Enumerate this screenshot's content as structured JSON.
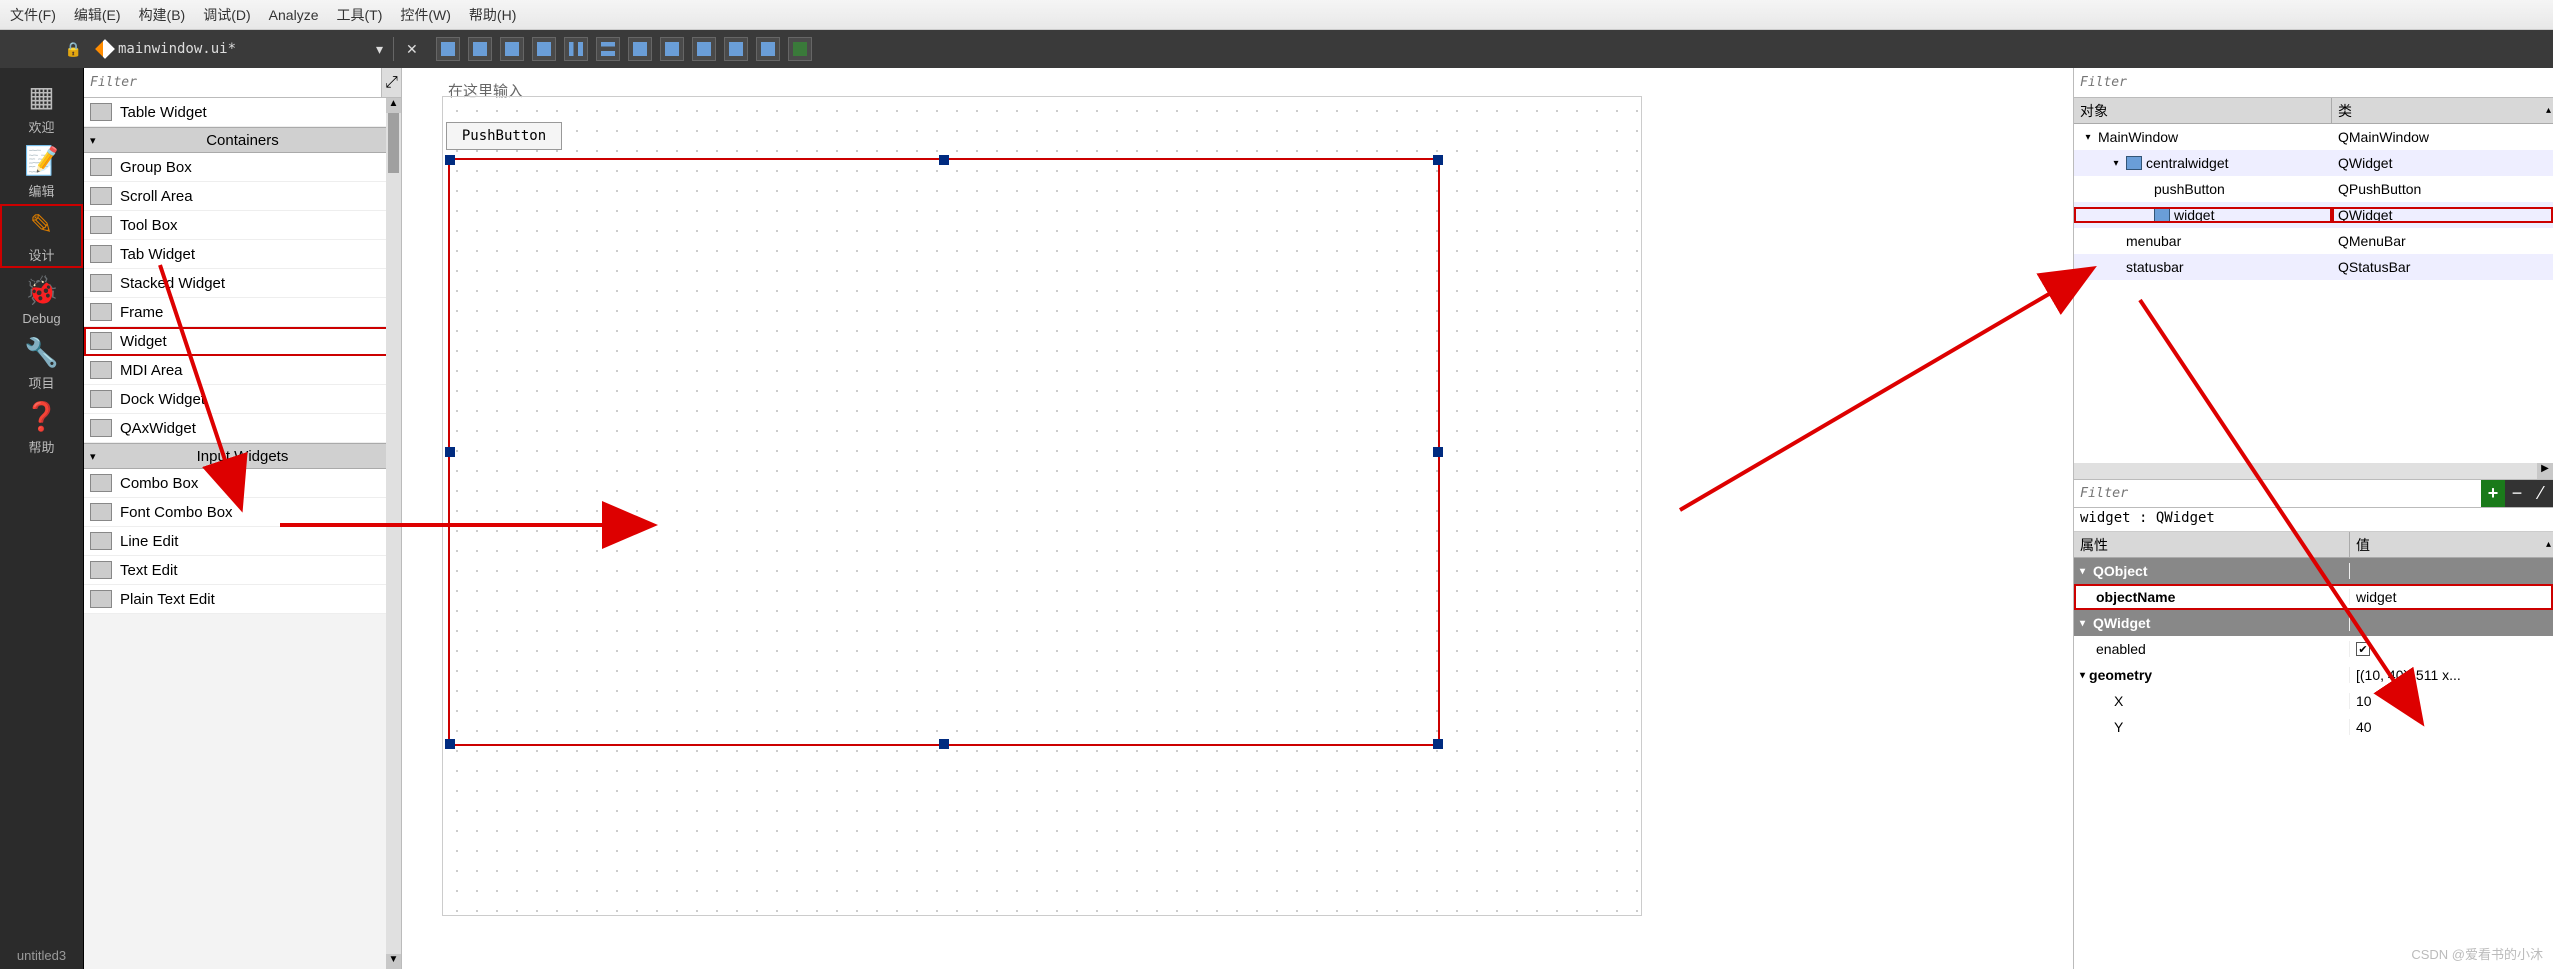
{
  "menu": {
    "items": [
      "文件(F)",
      "编辑(E)",
      "构建(B)",
      "调试(D)",
      "Analyze",
      "工具(T)",
      "控件(W)",
      "帮助(H)"
    ]
  },
  "filebar": {
    "filename": "mainwindow.ui*",
    "dropdown": "▾",
    "close": "✕"
  },
  "leftbar": {
    "items": [
      {
        "glyph": "▦",
        "label": "欢迎"
      },
      {
        "glyph": "📝",
        "label": "编辑"
      },
      {
        "glyph": "✎",
        "label": "设计",
        "active": true
      },
      {
        "glyph": "🐞",
        "label": "Debug"
      },
      {
        "glyph": "🔧",
        "label": "项目"
      },
      {
        "glyph": "❓",
        "label": "帮助"
      }
    ],
    "project": "untitled3"
  },
  "widgetbox": {
    "filter_placeholder": "Filter",
    "rows": [
      {
        "type": "item",
        "label": "Table Widget"
      },
      {
        "type": "header",
        "label": "Containers"
      },
      {
        "type": "item",
        "label": "Group Box"
      },
      {
        "type": "item",
        "label": "Scroll Area"
      },
      {
        "type": "item",
        "label": "Tool Box"
      },
      {
        "type": "item",
        "label": "Tab Widget"
      },
      {
        "type": "item",
        "label": "Stacked Widget"
      },
      {
        "type": "item",
        "label": "Frame"
      },
      {
        "type": "item",
        "label": "Widget",
        "highlight": true
      },
      {
        "type": "item",
        "label": "MDI Area"
      },
      {
        "type": "item",
        "label": "Dock Widget"
      },
      {
        "type": "item",
        "label": "QAxWidget"
      },
      {
        "type": "header",
        "label": "Input Widgets"
      },
      {
        "type": "item",
        "label": "Combo Box"
      },
      {
        "type": "item",
        "label": "Font Combo Box"
      },
      {
        "type": "item",
        "label": "Line Edit"
      },
      {
        "type": "item",
        "label": "Text Edit"
      },
      {
        "type": "item",
        "label": "Plain Text Edit"
      }
    ]
  },
  "canvas": {
    "hint": "在这里输入",
    "button_label": "PushButton"
  },
  "objtree": {
    "filter_placeholder": "Filter",
    "cols": [
      "对象",
      "类"
    ],
    "rows": [
      {
        "name": "MainWindow",
        "cls": "QMainWindow",
        "indent": 0,
        "tri": "▾"
      },
      {
        "name": "centralwidget",
        "cls": "QWidget",
        "indent": 1,
        "tri": "▾",
        "icon": true
      },
      {
        "name": "pushButton",
        "cls": "QPushButton",
        "indent": 2
      },
      {
        "name": "widget",
        "cls": "QWidget",
        "indent": 2,
        "icon": true,
        "highlight": true
      },
      {
        "name": "menubar",
        "cls": "QMenuBar",
        "indent": 1
      },
      {
        "name": "statusbar",
        "cls": "QStatusBar",
        "indent": 1
      }
    ]
  },
  "props": {
    "filter_placeholder": "Filter",
    "context": "widget : QWidget",
    "cols": [
      "属性",
      "值"
    ],
    "rows": [
      {
        "type": "cat",
        "name": "QObject"
      },
      {
        "type": "prop",
        "name": "objectName",
        "value": "widget",
        "bold": true,
        "highlight": true
      },
      {
        "type": "cat",
        "name": "QWidget"
      },
      {
        "type": "prop",
        "name": "enabled",
        "check": true
      },
      {
        "type": "prop",
        "name": "geometry",
        "value": "[(10, 40), 511 x...",
        "bold": true,
        "tri": "▾"
      },
      {
        "type": "prop",
        "name": "X",
        "value": "10",
        "sub": true
      },
      {
        "type": "prop",
        "name": "Y",
        "value": "40",
        "sub": true
      }
    ]
  },
  "watermark": "CSDN @爱看书的小沐"
}
